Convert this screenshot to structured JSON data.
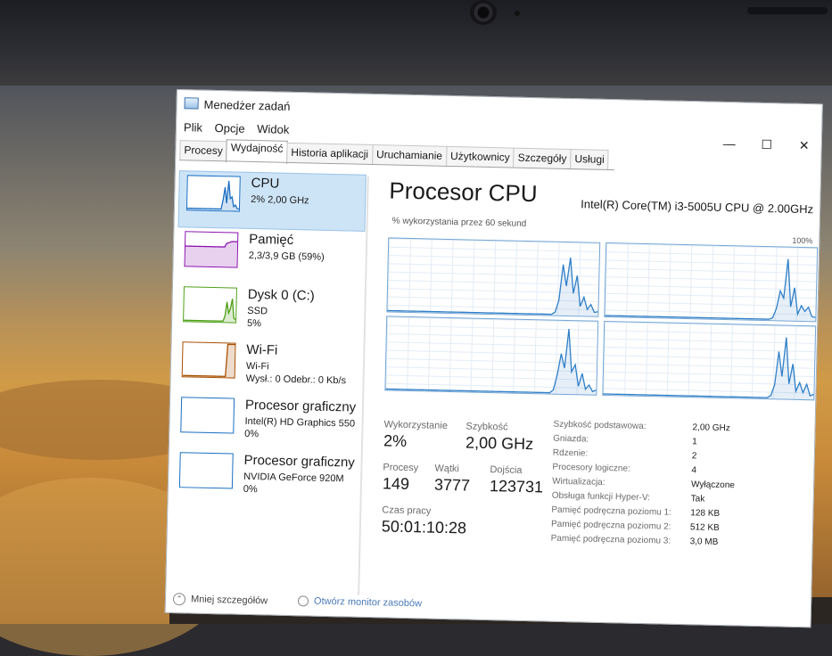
{
  "window": {
    "title": "Menedżer zadań",
    "minimize": "—",
    "maximize": "☐",
    "close": "✕"
  },
  "menu": [
    "Plik",
    "Opcje",
    "Widok"
  ],
  "tabs": [
    "Procesy",
    "Wydajność",
    "Historia aplikacji",
    "Uruchamianie",
    "Użytkownicy",
    "Szczegóły",
    "Usługi"
  ],
  "active_tab": "Wydajność",
  "sidebar": [
    {
      "name": "CPU",
      "line1": "2% 2,00 GHz",
      "line2": "",
      "color": "#1a6fc2"
    },
    {
      "name": "Pamięć",
      "line1": "2,3/3,9 GB (59%)",
      "line2": "",
      "color": "#8b12ae"
    },
    {
      "name": "Dysk 0 (C:)",
      "line1": "SSD",
      "line2": "5%",
      "color": "#4ea017"
    },
    {
      "name": "Wi-Fi",
      "line1": "Wi-Fi",
      "line2": "Wysł.: 0 Odebr.: 0 Kb/s",
      "color": "#a74f01"
    },
    {
      "name": "Procesor graficzny",
      "line1": "Intel(R) HD Graphics 550",
      "line2": "0%",
      "color": "#1a6fc2"
    },
    {
      "name": "Procesor graficzny",
      "line1": "NVIDIA GeForce 920M",
      "line2": "0%",
      "color": "#1a6fc2"
    }
  ],
  "main": {
    "title": "Procesor CPU",
    "model": "Intel(R) Core(TM) i3-5005U CPU @ 2.00GHz",
    "graph_caption": "% wykorzystania przez 60 sekund",
    "graph_max": "100%",
    "utilization_label": "Wykorzystanie",
    "utilization": "2%",
    "speed_label": "Szybkość",
    "speed": "2,00 GHz",
    "processes_label": "Procesy",
    "processes": "149",
    "threads_label": "Wątki",
    "threads": "3777",
    "handles_label": "Dojścia",
    "handles": "123731",
    "uptime_label": "Czas pracy",
    "uptime": "50:01:10:28"
  },
  "specs": [
    {
      "k": "Szybkość podstawowa:",
      "v": "2,00 GHz"
    },
    {
      "k": "Gniazda:",
      "v": "1"
    },
    {
      "k": "Rdzenie:",
      "v": "2"
    },
    {
      "k": "Procesory logiczne:",
      "v": "4"
    },
    {
      "k": "Wirtualizacja:",
      "v": "Wyłączone"
    },
    {
      "k": "Obsługa funkcji Hyper-V:",
      "v": "Tak"
    },
    {
      "k": "Pamięć podręczna poziomu 1:",
      "v": "128 KB"
    },
    {
      "k": "Pamięć podręczna poziomu 2:",
      "v": "512 KB"
    },
    {
      "k": "Pamięć podręczna poziomu 3:",
      "v": "3,0 MB"
    }
  ],
  "footer": {
    "less_details": "Mniej szczegółów",
    "resource_monitor": "Otwórz monitor zasobów"
  },
  "core_usage": [
    [
      0,
      0,
      0,
      0,
      0,
      0,
      0,
      0,
      0,
      0,
      0,
      0,
      0,
      0,
      0,
      0,
      0,
      0,
      0,
      0,
      0,
      0,
      0,
      0,
      0,
      0,
      0,
      0,
      0,
      0,
      0,
      0,
      0,
      0,
      0,
      0,
      0,
      0,
      0,
      0,
      0,
      0,
      0,
      0,
      0,
      0,
      0,
      3,
      20,
      70,
      40,
      80,
      30,
      55,
      12,
      25,
      8,
      15,
      4,
      5
    ],
    [
      0,
      0,
      0,
      0,
      0,
      0,
      0,
      0,
      0,
      0,
      0,
      0,
      0,
      0,
      0,
      0,
      0,
      0,
      0,
      0,
      0,
      0,
      0,
      0,
      0,
      0,
      0,
      0,
      0,
      0,
      0,
      0,
      0,
      0,
      0,
      0,
      0,
      0,
      0,
      0,
      0,
      0,
      0,
      0,
      0,
      0,
      0,
      2,
      15,
      40,
      30,
      85,
      18,
      45,
      8,
      20,
      12,
      18,
      5,
      4
    ],
    [
      0,
      0,
      0,
      0,
      0,
      0,
      0,
      0,
      0,
      0,
      0,
      0,
      0,
      0,
      0,
      0,
      0,
      0,
      0,
      0,
      0,
      0,
      0,
      0,
      0,
      0,
      0,
      0,
      0,
      0,
      0,
      0,
      0,
      0,
      0,
      0,
      0,
      0,
      0,
      0,
      0,
      0,
      0,
      0,
      0,
      0,
      0,
      4,
      25,
      55,
      35,
      90,
      30,
      40,
      10,
      28,
      6,
      12,
      3,
      5
    ],
    [
      0,
      0,
      0,
      0,
      0,
      0,
      0,
      0,
      0,
      0,
      0,
      0,
      0,
      0,
      0,
      0,
      0,
      0,
      0,
      0,
      0,
      0,
      0,
      0,
      0,
      0,
      0,
      0,
      0,
      0,
      0,
      0,
      0,
      0,
      0,
      0,
      0,
      0,
      0,
      0,
      0,
      0,
      0,
      0,
      0,
      0,
      0,
      3,
      18,
      65,
      30,
      85,
      20,
      48,
      10,
      22,
      8,
      20,
      4,
      6
    ]
  ],
  "thumb_cpu": [
    2,
    2,
    2,
    2,
    2,
    2,
    2,
    2,
    2,
    2,
    2,
    2,
    2,
    2,
    2,
    2,
    2,
    2,
    2,
    2,
    30,
    70,
    20,
    90,
    35,
    40,
    10,
    15,
    4,
    3
  ],
  "thumb_mem": [
    59,
    59,
    59,
    59,
    59,
    59,
    59,
    59,
    59,
    59,
    59,
    59,
    59,
    59,
    59,
    59,
    59,
    59,
    59,
    59,
    59,
    59,
    59,
    70,
    72,
    74,
    76,
    76,
    76,
    76
  ],
  "thumb_disk": [
    0,
    0,
    0,
    0,
    0,
    0,
    0,
    0,
    0,
    0,
    0,
    0,
    0,
    0,
    0,
    0,
    0,
    0,
    0,
    0,
    0,
    0,
    0,
    15,
    60,
    25,
    40,
    70,
    10,
    5
  ],
  "thumb_wifi": [
    0,
    0,
    0,
    0,
    0,
    0,
    0,
    0,
    0,
    0,
    0,
    0,
    0,
    0,
    0,
    0,
    0,
    0,
    0,
    0,
    0,
    0,
    0,
    0,
    0,
    100,
    100,
    100,
    100,
    100
  ]
}
